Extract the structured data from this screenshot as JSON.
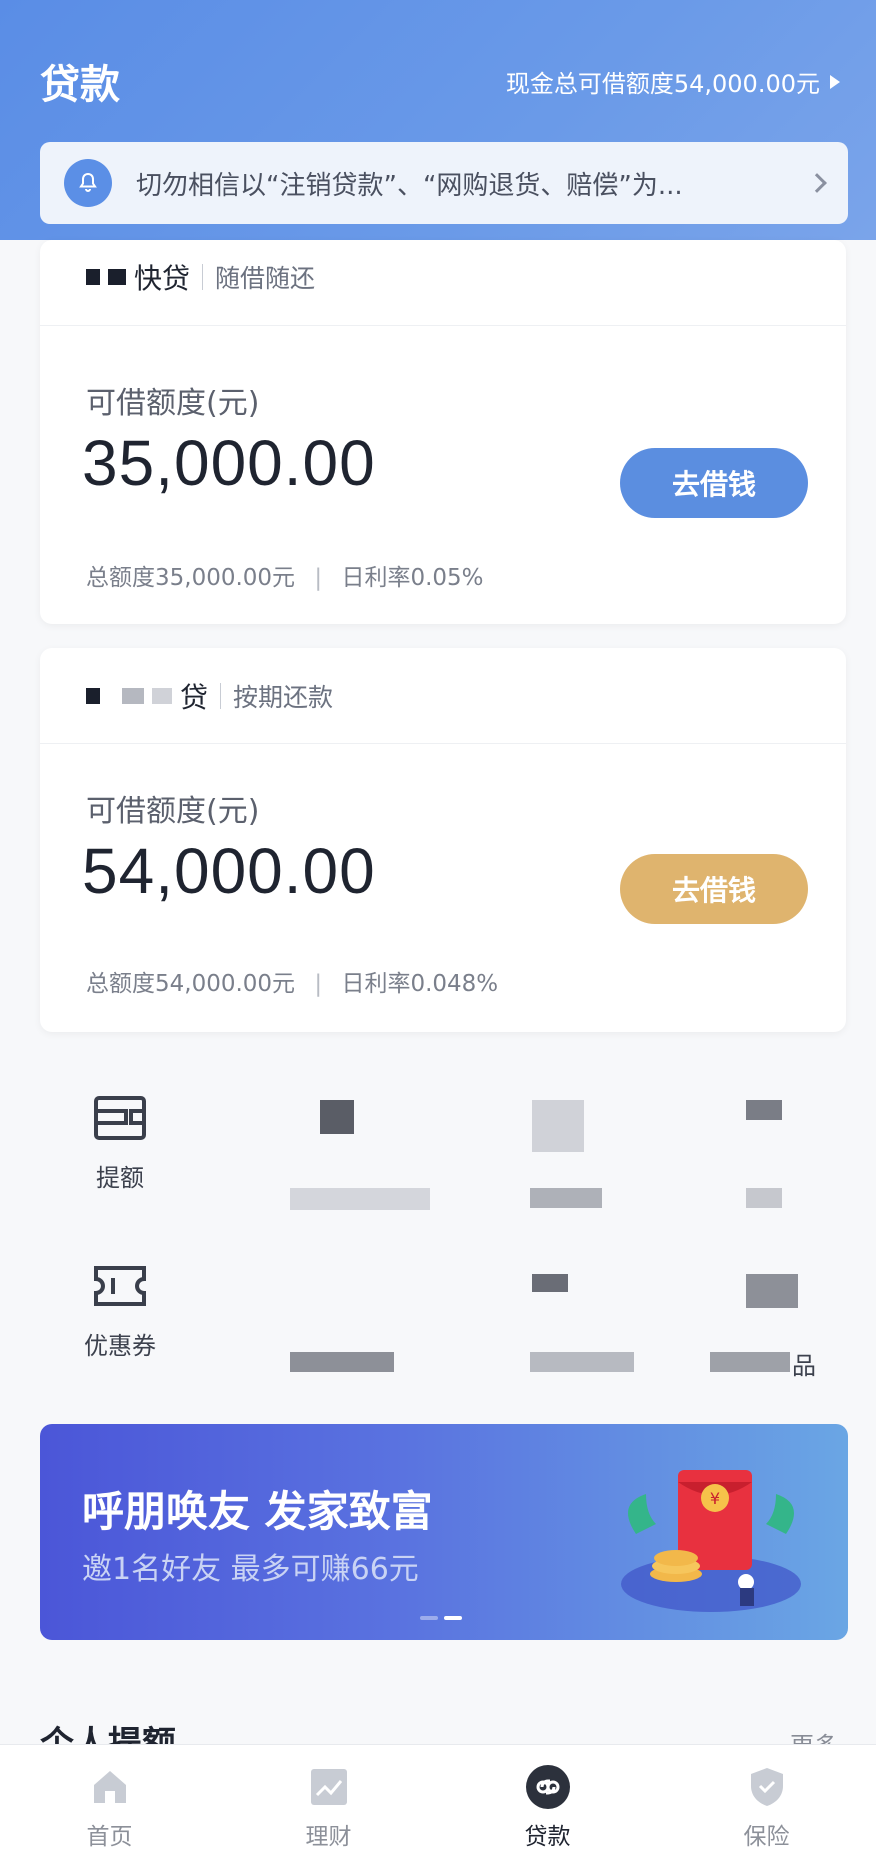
{
  "header": {
    "title": "贷款",
    "quota_text": "现金总可借额度54,000.00元"
  },
  "notice": {
    "text": "切勿相信以“注销贷款”、“网购退货、赔偿”为..."
  },
  "loans": [
    {
      "name_visible": "快贷",
      "tag": "随借随还",
      "amount_label": "可借额度(元)",
      "amount": "35,000.00",
      "button": "去借钱",
      "button_color": "#5b8ee0",
      "total": "总额度35,000.00元",
      "rate": "日利率0.05%"
    },
    {
      "name_visible": "贷",
      "tag": "按期还款",
      "amount_label": "可借额度(元)",
      "amount": "54,000.00",
      "button": "去借钱",
      "button_color": "#dfb46e",
      "total": "总额度54,000.00元",
      "rate": "日利率0.048%"
    }
  ],
  "grid": {
    "items": [
      {
        "label": "提额",
        "icon": "wallet-icon"
      },
      {
        "label": "优惠券",
        "icon": "ticket-icon"
      },
      {
        "label": "品",
        "icon": "blurred-icon"
      }
    ]
  },
  "banner": {
    "title": "呼朋唤友  发家致富",
    "subtitle": "邀1名好友 最多可赚66元"
  },
  "section": {
    "title_peek": "个人提额",
    "more_peek": "更多"
  },
  "tabs": [
    {
      "label": "首页",
      "icon": "home-icon",
      "active": false
    },
    {
      "label": "理财",
      "icon": "chart-icon",
      "active": false
    },
    {
      "label": "贷款",
      "icon": "link-icon",
      "active": true
    },
    {
      "label": "保险",
      "icon": "shield-icon",
      "active": false
    }
  ],
  "colors": {
    "brand_blue": "#5b8ee0",
    "gold": "#dfb46e"
  }
}
